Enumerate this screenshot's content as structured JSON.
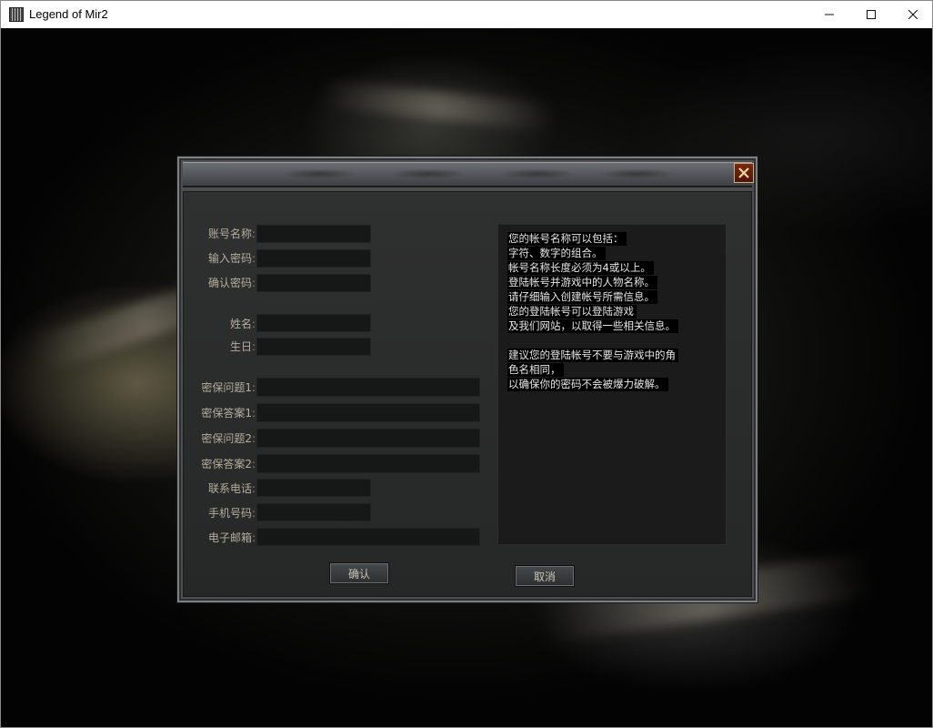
{
  "window": {
    "title": "Legend of Mir2"
  },
  "form": {
    "labels": {
      "account_name": "账号名称",
      "password": "输入密码",
      "confirm_password": "确认密码",
      "name": "姓名",
      "birthday": "生日",
      "question1": "密保问题1",
      "answer1": "密保答案1",
      "question2": "密保问题2",
      "answer2": "密保答案2",
      "phone": "联系电话",
      "mobile": "手机号码",
      "email": "电子邮箱",
      "colon": ":"
    },
    "values": {
      "account_name": "",
      "password": "",
      "confirm_password": "",
      "name": "",
      "birthday": "",
      "question1": "",
      "answer1": "",
      "question2": "",
      "answer2": "",
      "phone": "",
      "mobile": "",
      "email": ""
    }
  },
  "info": {
    "lines": [
      "您的帐号名称可以包括：",
      "字符、数字的组合。",
      "帐号名称长度必须为4或以上。",
      "登陆帐号并游戏中的人物名称。",
      "请仔细输入创建帐号所需信息。",
      "您的登陆帐号可以登陆游戏",
      "及我们网站，以取得一些相关信息。",
      "建议您的登陆帐号不要与游戏中的角",
      "色名相同，",
      "以确保你的密码不会被爆力破解。"
    ]
  },
  "buttons": {
    "confirm": "确认",
    "cancel": "取消"
  },
  "icons": {
    "app": "app-icon",
    "dialog_close": "close-x-icon"
  },
  "colors": {
    "label": "#b6ae9e",
    "close_button": "#6a1f0c",
    "info_text": "#e6e6e6"
  }
}
